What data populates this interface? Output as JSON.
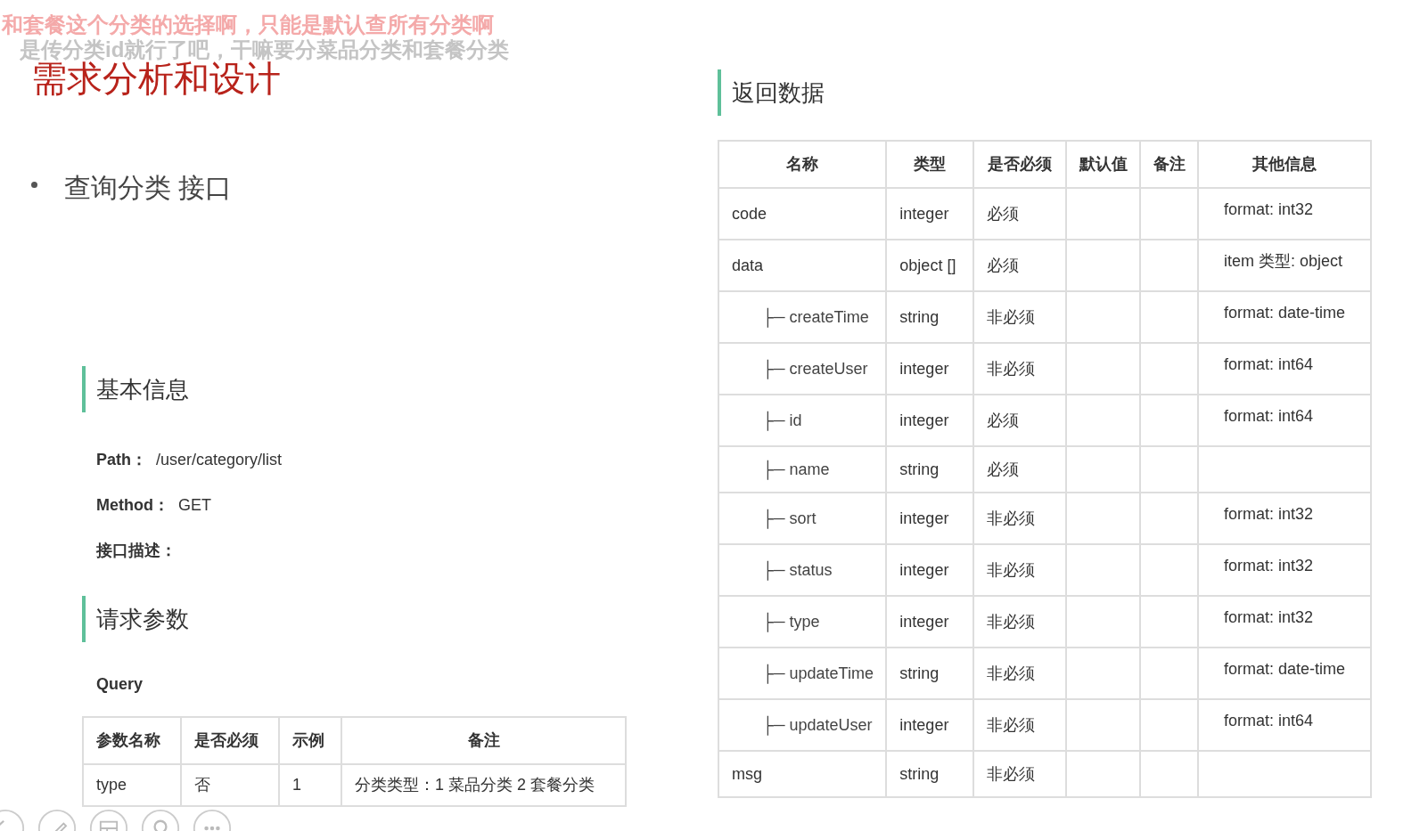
{
  "comments": [
    {
      "text": "和套餐这个分类的选择啊，只能是默认查所有分类啊",
      "color": "#f4a9a9"
    },
    {
      "text": "是传分类id就行了吧，干嘛要分菜品分类和套餐分类",
      "color": "#c4c4c4"
    }
  ],
  "slide": {
    "title": "需求分析和设计",
    "bullet": "查询分类 接口",
    "basic": {
      "heading": "基本信息",
      "fields": [
        {
          "label": "Path：",
          "value": "/user/category/list"
        },
        {
          "label": "Method：",
          "value": "GET"
        },
        {
          "label": "接口描述："
        }
      ]
    },
    "request": {
      "heading": "请求参数",
      "subheading": "Query",
      "columns": [
        "参数名称",
        "是否必须",
        "示例",
        "备注"
      ],
      "rows": [
        [
          "type",
          "否",
          "1",
          "分类类型：1 菜品分类 2 套餐分类"
        ]
      ]
    },
    "response": {
      "heading": "返回数据",
      "columns": [
        "名称",
        "类型",
        "是否必须",
        "默认值",
        "备注",
        "其他信息"
      ],
      "rows": [
        {
          "name": "code",
          "type": "integer",
          "required": "必须",
          "info": "format: int32"
        },
        {
          "name": "data",
          "type": "object []",
          "required": "必须",
          "info": "item 类型: object",
          "children": [
            {
              "name": "├─ createTime",
              "type": "string",
              "required": "非必须",
              "info": "format: date-time"
            },
            {
              "name": "├─ createUser",
              "type": "integer",
              "required": "非必须",
              "info": "format: int64"
            },
            {
              "name": "├─ id",
              "type": "integer",
              "required": "必须",
              "info": "format: int64"
            },
            {
              "name": "├─ name",
              "type": "string",
              "required": "必须"
            },
            {
              "name": "├─ sort",
              "type": "integer",
              "required": "非必须",
              "info": "format: int32"
            },
            {
              "name": "├─ status",
              "type": "integer",
              "required": "非必须",
              "info": "format: int32"
            },
            {
              "name": "├─ type",
              "type": "integer",
              "required": "非必须",
              "info": "format: int32"
            },
            {
              "name": "├─ updateTime",
              "type": "string",
              "required": "非必须",
              "info": "format: date-time"
            },
            {
              "name": "├─ updateUser",
              "type": "integer",
              "required": "非必须",
              "info": "format: int64"
            }
          ]
        },
        {
          "name": "msg",
          "type": "string",
          "required": "非必须"
        }
      ]
    }
  }
}
